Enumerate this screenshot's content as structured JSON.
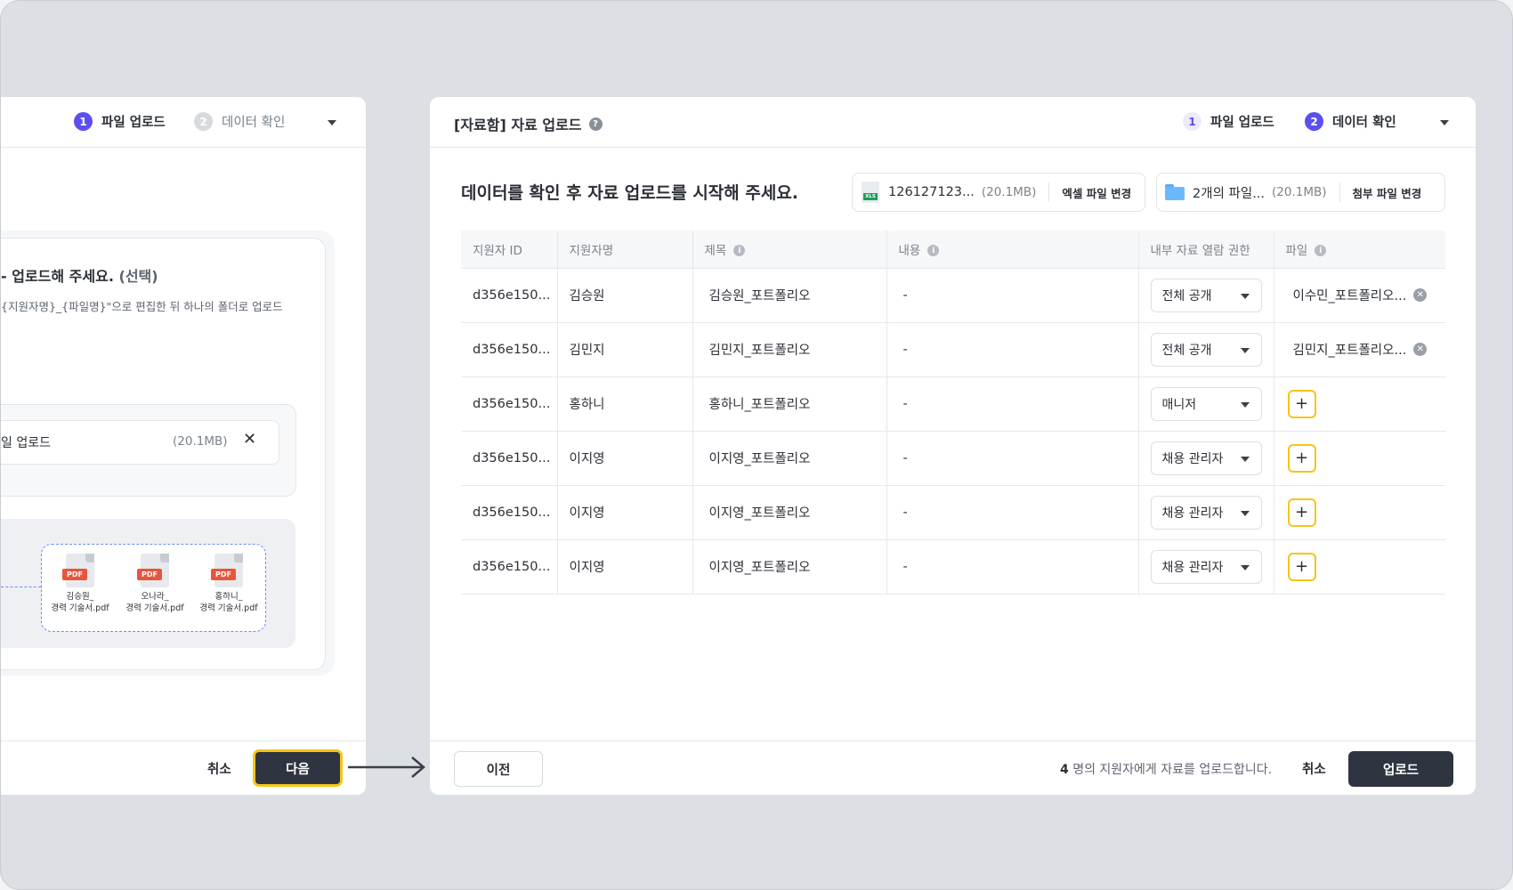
{
  "left_panel": {
    "steps": [
      {
        "num": "1",
        "label": "파일 업로드"
      },
      {
        "num": "2",
        "label": "데이터 확인"
      }
    ],
    "title": "업로드해 주세요.",
    "title_optional": "(선택)",
    "title_prefix": "-",
    "description": "{지원자명}_{파일명}\"으로 편집한 뒤 하나의 폴더로 업로드",
    "file": {
      "name": "일 업로드",
      "size": "(20.1MB)"
    },
    "pdfs": [
      {
        "line1": "김승원_",
        "line2": "경력 기술서.pdf"
      },
      {
        "line1": "오나라_",
        "line2": "경력 기술서.pdf"
      },
      {
        "line1": "홍하니_",
        "line2": "경력 기술서.pdf"
      }
    ],
    "pdf_tag": "PDF",
    "cancel_label": "취소",
    "next_label": "다음"
  },
  "right_panel": {
    "title": "[자료함] 자료 업로드",
    "steps": [
      {
        "num": "1",
        "label": "파일 업로드"
      },
      {
        "num": "2",
        "label": "데이터 확인"
      }
    ],
    "heading": "데이터를 확인 후 자료 업로드를 시작해 주세요.",
    "excel_file": {
      "name": "126127123...",
      "size": "(20.1MB)",
      "change_label": "엑셀 파일 변경",
      "icon_text": "XLS"
    },
    "attach_file": {
      "name": "2개의 파일...",
      "size": "(20.1MB)",
      "change_label": "첨부 파일 변경"
    },
    "table": {
      "headers": [
        "지원자 ID",
        "지원자명",
        "제목",
        "내용",
        "내부 자료 열람 권한",
        "파일"
      ],
      "rows": [
        {
          "id": "d356e150...",
          "name": "김승원",
          "title": "김승원_포트폴리오",
          "content": "-",
          "permission": "전체 공개",
          "file": "이수민_포트폴리오..."
        },
        {
          "id": "d356e150...",
          "name": "김민지",
          "title": "김민지_포트폴리오",
          "content": "-",
          "permission": "전체 공개",
          "file": "김민지_포트폴리오..."
        },
        {
          "id": "d356e150...",
          "name": "홍하니",
          "title": "홍하니_포트폴리오",
          "content": "-",
          "permission": "매니저",
          "file": ""
        },
        {
          "id": "d356e150...",
          "name": "이지영",
          "title": "이지영_포트폴리오",
          "content": "-",
          "permission": "채용 관리자",
          "file": ""
        },
        {
          "id": "d356e150...",
          "name": "이지영",
          "title": "이지영_포트폴리오",
          "content": "-",
          "permission": "채용 관리자",
          "file": ""
        },
        {
          "id": "d356e150...",
          "name": "이지영",
          "title": "이지영_포트폴리오",
          "content": "-",
          "permission": "채용 관리자",
          "file": ""
        }
      ]
    },
    "footer": {
      "prev_label": "이전",
      "count": "4",
      "summary_text": "명의 지원자에게 자료를 업로드합니다.",
      "cancel_label": "취소",
      "upload_label": "업로드"
    }
  },
  "colors": {
    "accent": "#5b4ff0",
    "highlight": "#f5c518",
    "primary_button": "#2e3440"
  }
}
